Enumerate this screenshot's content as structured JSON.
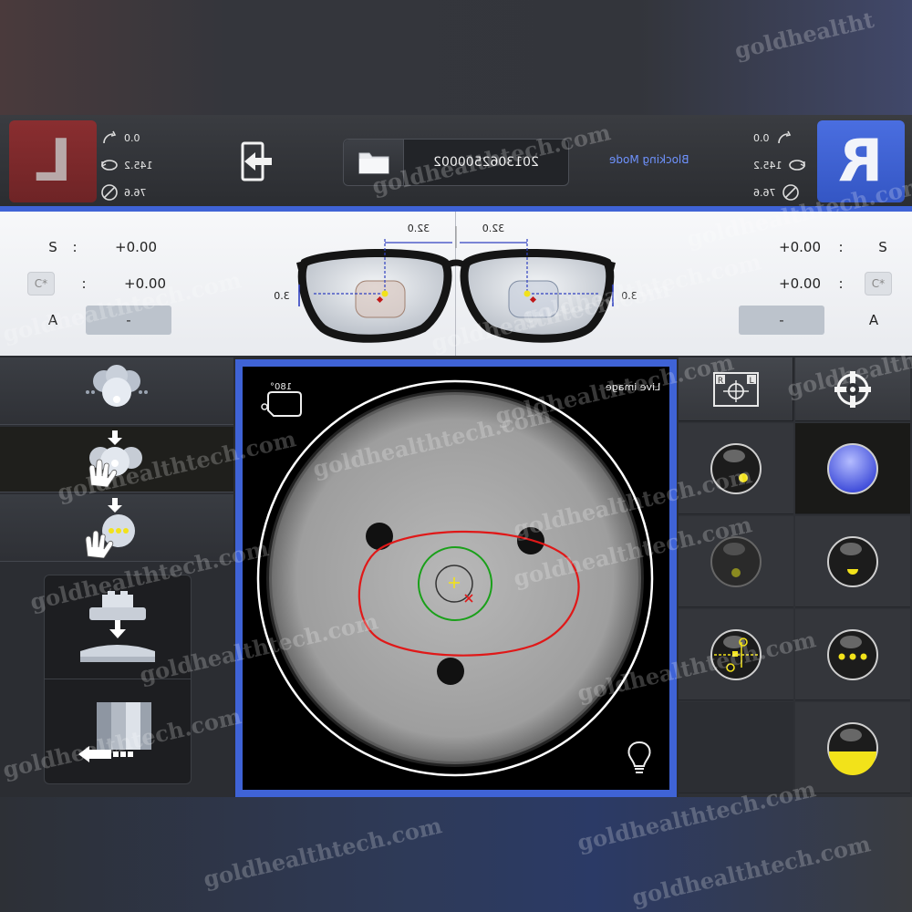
{
  "header": {
    "left_eye": "L",
    "right_eye": "R",
    "left_measures": [
      "0.0",
      "145.2",
      "76.6"
    ],
    "right_measures": [
      "0.0",
      "145.2",
      "76.6"
    ],
    "file_id": "2013062500002",
    "mode": "Blocking Mode"
  },
  "lens": {
    "left": {
      "s_label": "S",
      "s_value": "+0.00",
      "c_value": "+0.00",
      "a_label": "A",
      "a_value": "-",
      "cyl_icon": "C*"
    },
    "right": {
      "s_label": "S",
      "s_value": "+0.00",
      "c_value": "+0.00",
      "a_label": "A",
      "a_value": "-",
      "cyl_icon": "C*"
    },
    "colon": ":",
    "pd_left": "32.0",
    "pd_right": "32.0",
    "height_left": "3.0",
    "height_right": "3.0"
  },
  "viewer": {
    "title": "Live image",
    "rotation": "180°"
  },
  "colors": {
    "accent": "#3f63d6",
    "left_eye": "#7a2a2c",
    "right_eye": "#4066dc",
    "marker_yellow": "#f2e21a",
    "contour_red": "#e01818",
    "ring_green": "#1aa01a"
  },
  "watermarks": [
    "goldhealtht",
    "goldhealthtech.com",
    "goldhealthtech.com",
    "goldhealthtech.com",
    "goldhealthtech.com",
    "goldhealthtech.com",
    "goldhealthtech.com",
    "goldhealthtech.com",
    "goldhealthtech.com",
    "goldhealthtech.com",
    "goldhealthtech.com",
    "goldhealthtech.com",
    "goldhealthtech.com",
    "goldhealthtech.com",
    "goldhealthtech.com",
    "goldhealthtech.com",
    "goldhealthtech.com",
    "goldhealthtech.com",
    "goldhealthtech.com"
  ]
}
